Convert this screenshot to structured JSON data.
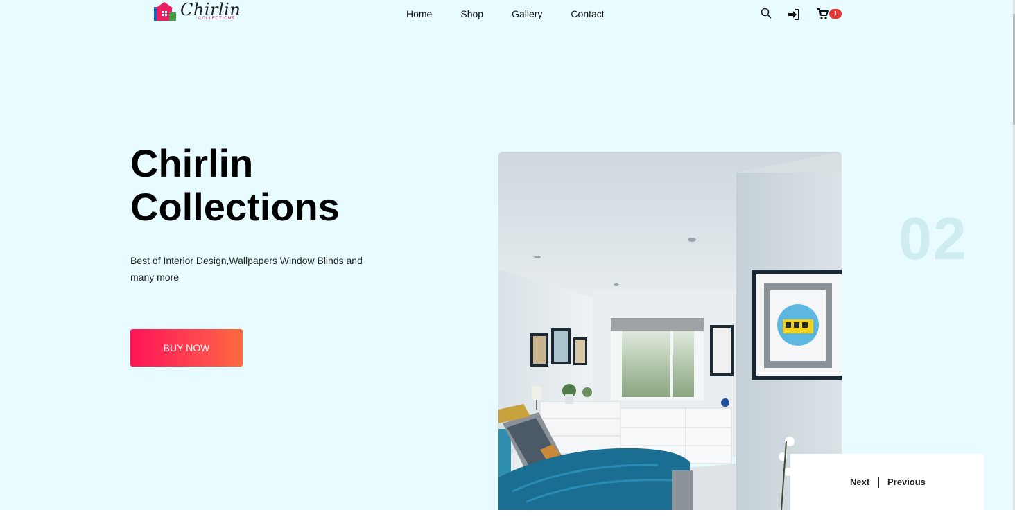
{
  "brand": {
    "name": "Chirlin",
    "tagline": "COLLECTIONS",
    "colors": {
      "hero_bg": "#e8fcff",
      "accent_start": "#ff1458",
      "accent_end": "#ff6a3d",
      "badge": "#e53935"
    }
  },
  "nav": {
    "items": [
      {
        "label": "Home"
      },
      {
        "label": "Shop"
      },
      {
        "label": "Gallery"
      },
      {
        "label": "Contact"
      }
    ]
  },
  "header_icons": {
    "search": "search-icon",
    "login": "sign-in-icon",
    "cart": "cart-icon",
    "cart_count": "1"
  },
  "hero": {
    "title_line1": "Chirlin",
    "title_line2": "Collections",
    "subtitle": "Best of Interior Design,Wallpapers Window Blinds and many more",
    "cta_label": "BUY NOW",
    "slide_number": "02",
    "image_alt_icon": "bedroom-photo"
  },
  "slider_nav": {
    "next_label": "Next",
    "previous_label": "Previous"
  }
}
